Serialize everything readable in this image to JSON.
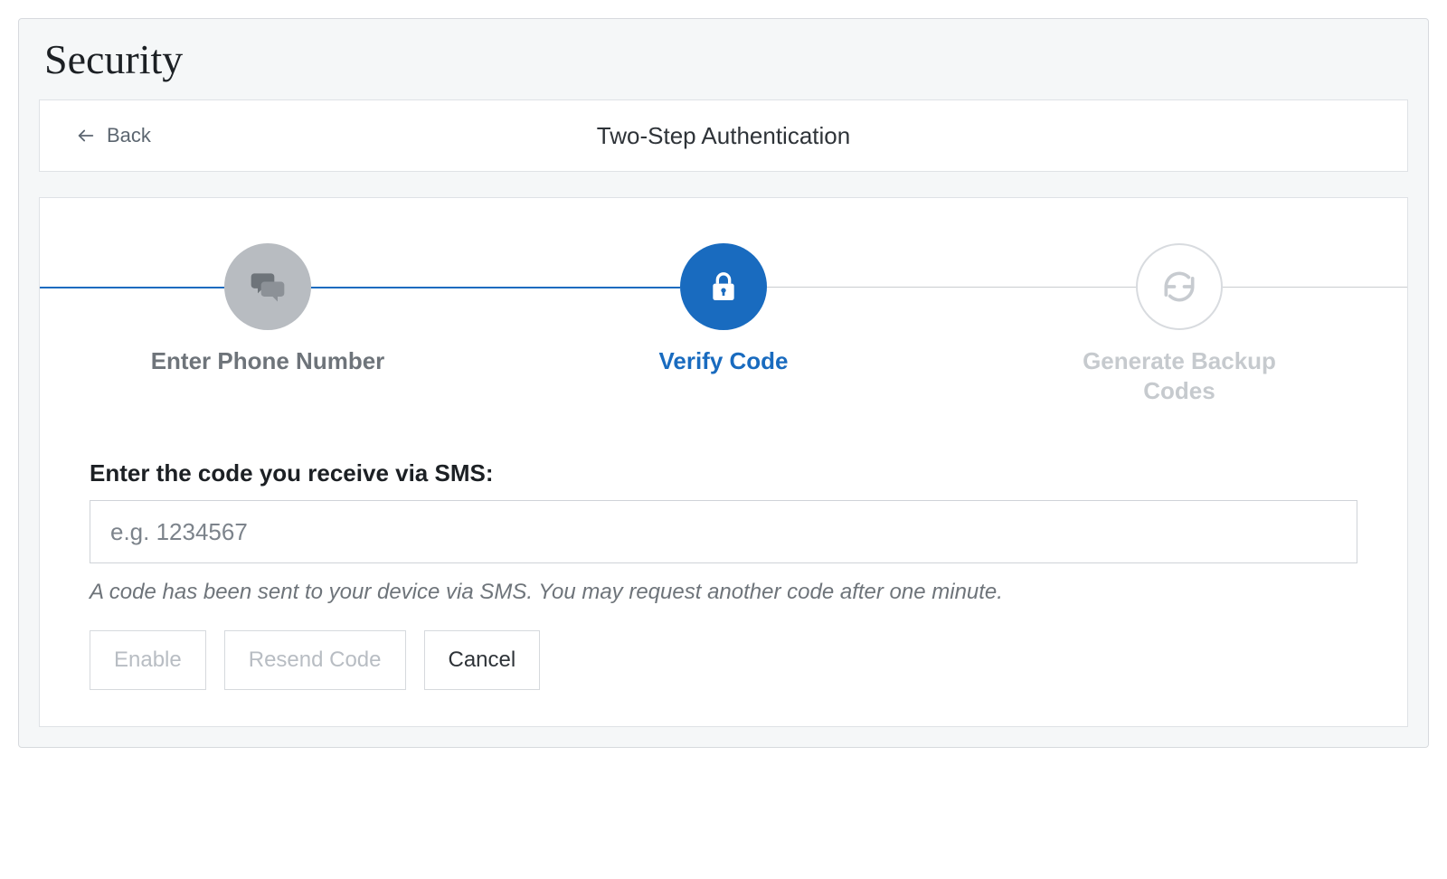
{
  "page": {
    "title": "Security"
  },
  "header": {
    "back_label": "Back",
    "title": "Two-Step Authentication"
  },
  "steps": [
    {
      "label": "Enter Phone Number"
    },
    {
      "label": "Verify Code"
    },
    {
      "label": "Generate Backup Codes"
    }
  ],
  "form": {
    "label": "Enter the code you receive via SMS:",
    "placeholder": "e.g. 1234567",
    "hint": "A code has been sent to your device via SMS. You may request another code after one minute."
  },
  "buttons": {
    "enable": "Enable",
    "resend": "Resend Code",
    "cancel": "Cancel"
  }
}
